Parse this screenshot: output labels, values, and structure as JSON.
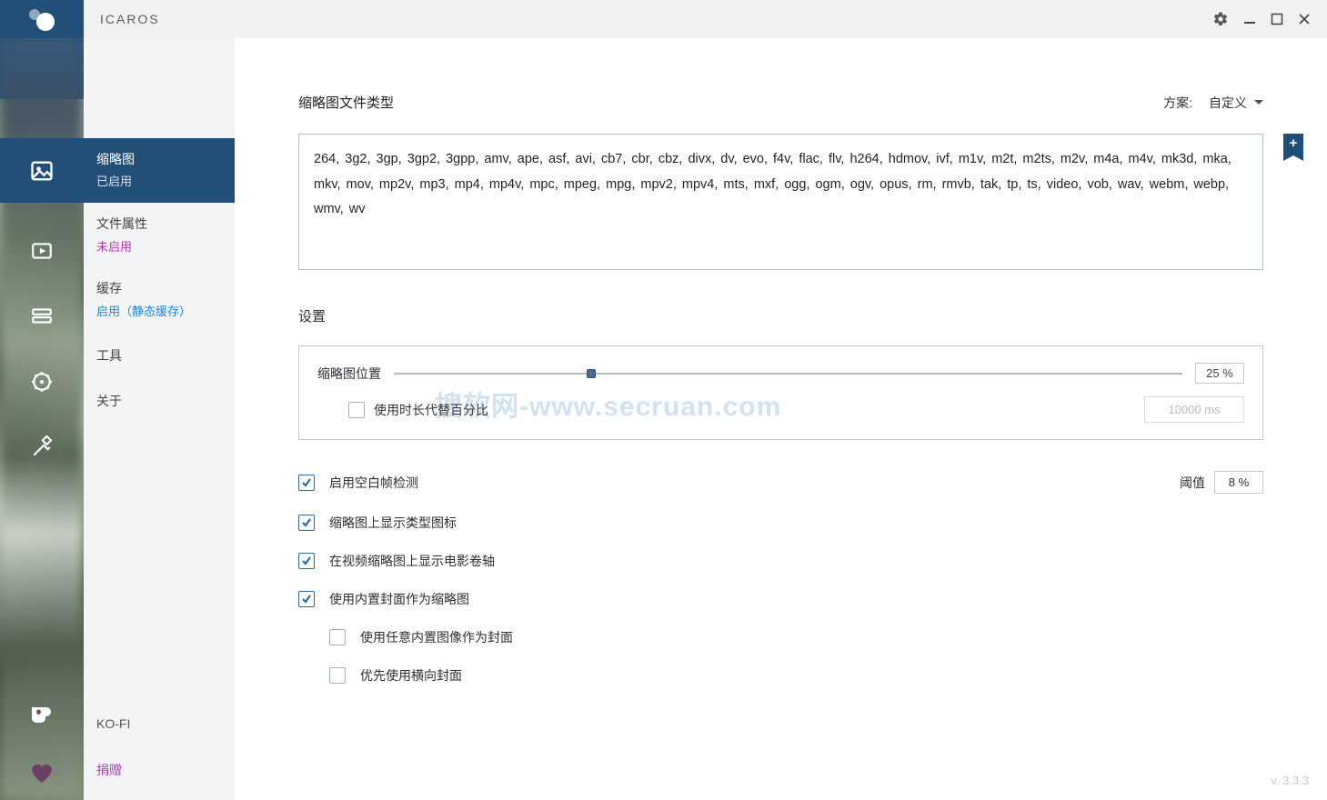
{
  "window": {
    "title": "ICAROS",
    "version": "v. 3.3.3"
  },
  "sidebar": {
    "items": [
      {
        "label": "缩略图",
        "status": "已启用"
      },
      {
        "label": "文件属性",
        "status": "未启用"
      },
      {
        "label": "缓存",
        "status": "启用（静态缓存）"
      },
      {
        "label": "工具"
      },
      {
        "label": "关于"
      }
    ],
    "kofi": "KO-FI",
    "donate": "捐赠"
  },
  "thumbnail_types": {
    "title": "缩略图文件类型",
    "scheme_label": "方案:",
    "scheme_value": "自定义",
    "extensions": "264, 3g2, 3gp, 3gp2, 3gpp, amv, ape, asf, avi, cb7, cbr, cbz, divx, dv, evo, f4v, flac, flv, h264, hdmov, ivf, m1v, m2t, m2ts, m2v, m4a, m4v, mk3d, mka, mkv, mov, mp2v, mp3, mp4, mp4v, mpc, mpeg, mpg, mpv2, mpv4, mts, mxf, ogg, ogm, ogv, opus, rm, rmvb, tak, tp, ts, video, vob, wav, webm, webp, wmv, wv"
  },
  "settings": {
    "title": "设置",
    "offset": {
      "label": "缩略图位置",
      "percent": "25 %",
      "use_duration_label": "使用时长代替百分比",
      "duration_value": "10000 ms"
    },
    "options": {
      "blank_detect": "启用空白帧检测",
      "threshold_label": "阈值",
      "threshold_value": "8 %",
      "show_type_icon": "缩略图上显示类型图标",
      "film_reel": "在视频缩略图上显示电影卷轴",
      "use_embedded_cover": "使用内置封面作为缩略图",
      "use_any_image": "使用任意内置图像作为封面",
      "prefer_landscape": "优先使用横向封面"
    }
  },
  "watermark": "搜软网-www.secruan.com"
}
